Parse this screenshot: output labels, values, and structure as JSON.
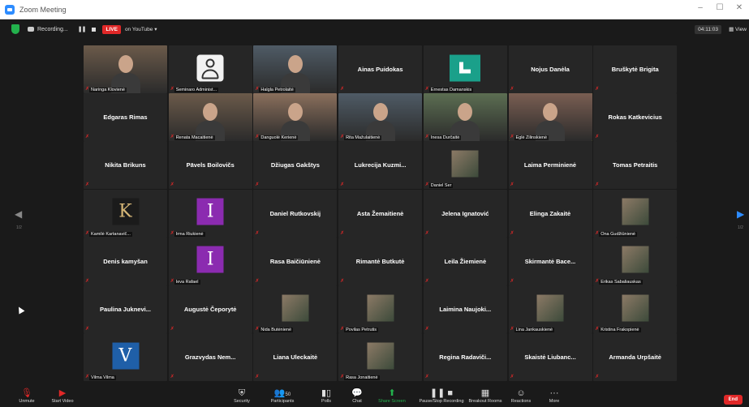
{
  "window": {
    "title": "Zoom Meeting",
    "minimize": "–",
    "maximize": "☐",
    "close": "✕"
  },
  "topbar": {
    "recording_label": "Recording...",
    "live_label": "LIVE",
    "stream_label": "on YouTube ▾",
    "timer": "04:11:03",
    "view_label": "View"
  },
  "pager": {
    "left": "1/2",
    "right": "1/2"
  },
  "colors": {
    "active_speaker": "#a7d130",
    "muted_mic": "#e02828",
    "tile_bg": "#262626",
    "live": "#e02828",
    "end": "#e02828"
  },
  "participants": [
    {
      "name": "Naringa Klovienė",
      "kind": "video",
      "icon": "person-video"
    },
    {
      "name": "Seminaro Administ...",
      "kind": "avatar",
      "icon": "user-silhouette-icon"
    },
    {
      "name": "Halgla Petrolaitė",
      "kind": "video",
      "icon": "person-video"
    },
    {
      "name": "Ainas Puidokas",
      "kind": "name"
    },
    {
      "name": "Ernestas Damanskis",
      "kind": "image",
      "icon": "logo-l"
    },
    {
      "name": "Nojus Danėla",
      "kind": "name"
    },
    {
      "name": "Bruškytė Brigita",
      "kind": "name"
    },
    {
      "name": "Edgaras Rimas",
      "kind": "name"
    },
    {
      "name": "Renata Macaitienė",
      "kind": "video",
      "icon": "person-video"
    },
    {
      "name": "Danguolė Kerienė",
      "kind": "video",
      "icon": "person-video"
    },
    {
      "name": "Rita Mažulaitienė",
      "kind": "video",
      "icon": "person-video"
    },
    {
      "name": "Inesa Durčaitė",
      "kind": "video",
      "icon": "person-video"
    },
    {
      "name": "Eglė Žilinskienė",
      "kind": "video",
      "icon": "person-video",
      "active": true
    },
    {
      "name": "Rokas Katkevicius",
      "kind": "name"
    },
    {
      "name": "Nikita Brikuns",
      "kind": "name"
    },
    {
      "name": "Pāvels Boilovičs",
      "kind": "name"
    },
    {
      "name": "Džiugas Gakštys",
      "kind": "name"
    },
    {
      "name": "Lukrecija Kuzmi...",
      "kind": "name"
    },
    {
      "name": "Daniel Šer",
      "kind": "image",
      "icon": "photo"
    },
    {
      "name": "Laima Perminienė",
      "kind": "name"
    },
    {
      "name": "Tomas Petraitis",
      "kind": "name"
    },
    {
      "name": "Kamilė Kartanavič...",
      "kind": "image",
      "icon": "letter-k",
      "letter": "K"
    },
    {
      "name": "Irma Riukienė",
      "kind": "image",
      "icon": "letter-i",
      "letter": "I"
    },
    {
      "name": "Daniel Rutkovskij",
      "kind": "name"
    },
    {
      "name": "Asta Žemaitienė",
      "kind": "name"
    },
    {
      "name": "Jelena Ignatović",
      "kind": "name"
    },
    {
      "name": "Elinga Zakaitė",
      "kind": "name"
    },
    {
      "name": "Ona Gudžiūnienė",
      "kind": "image",
      "icon": "photo"
    },
    {
      "name": "Denis kamyšan",
      "kind": "name"
    },
    {
      "name": "Ieva Rafael",
      "kind": "image",
      "icon": "letter-i",
      "letter": "I"
    },
    {
      "name": "Rasa Baičiūnienė",
      "kind": "name"
    },
    {
      "name": "Rimantė Butkutė",
      "kind": "name"
    },
    {
      "name": "Leila Žiemienė",
      "kind": "name"
    },
    {
      "name": "Skirmantė Bace...",
      "kind": "name"
    },
    {
      "name": "Erikas Sabaliauskas",
      "kind": "image",
      "icon": "photo"
    },
    {
      "name": "Paulina Juknevi...",
      "kind": "name"
    },
    {
      "name": "Augustė Čeporytė",
      "kind": "name"
    },
    {
      "name": "Nida Butėnienė",
      "kind": "image",
      "icon": "photo"
    },
    {
      "name": "Povilas Petrutis",
      "kind": "image",
      "icon": "photo"
    },
    {
      "name": "Laimina Naujoki...",
      "kind": "name"
    },
    {
      "name": "Lina Jankauskienė",
      "kind": "image",
      "icon": "photo"
    },
    {
      "name": "Kristina Frakopienė",
      "kind": "image",
      "icon": "photo"
    },
    {
      "name": "Vilma Vilma",
      "kind": "image",
      "icon": "letter-v",
      "letter": "V"
    },
    {
      "name": "Grazvydas Nem...",
      "kind": "name"
    },
    {
      "name": "Liana Uleckaitė",
      "kind": "name"
    },
    {
      "name": "Rasa Jonaitienė",
      "kind": "image",
      "icon": "photo"
    },
    {
      "name": "Regina Radaviči...",
      "kind": "name"
    },
    {
      "name": "Skaistė Liubanc...",
      "kind": "name"
    },
    {
      "name": "Armanda Urpšaitė",
      "kind": "name"
    }
  ],
  "toolbar": {
    "unmute": "Unmute",
    "start_video": "Start Video",
    "security": "Security",
    "participants": "Participants",
    "participants_count": "50",
    "polls": "Polls",
    "chat": "Chat",
    "share_screen": "Share Screen",
    "pause_recording": "Pause/Stop Recording",
    "breakout_rooms": "Breakout Rooms",
    "reactions": "Reactions",
    "more": "More",
    "end": "End"
  }
}
